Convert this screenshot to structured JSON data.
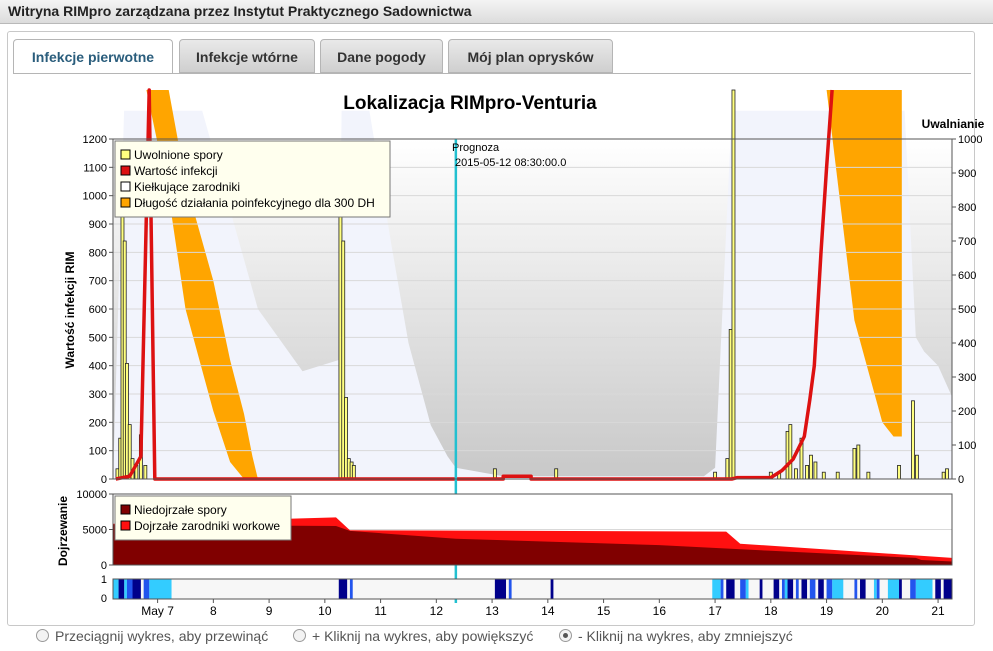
{
  "window": {
    "title": "Witryna RIMpro zarządzana przez Instytut Praktycznego Sadownictwa"
  },
  "tabs": [
    {
      "label": "Infekcje pierwotne",
      "active": true
    },
    {
      "label": "Infekcje wtórne",
      "active": false
    },
    {
      "label": "Dane pogody",
      "active": false
    },
    {
      "label": "Mój plan oprysków",
      "active": false
    }
  ],
  "colors": {
    "released_spores": "#ffff80",
    "infection_value": "#dd1111",
    "germinating": "#f2f4fc",
    "postinfection": "#ffa500",
    "immature": "#800000",
    "mature": "#ff1010",
    "forecast_line": "#22c0d0",
    "wet_dark": "#00008b",
    "wet_mid": "#2255ee",
    "wet_light": "#33ccff"
  },
  "chart_data": {
    "type": "bar",
    "title": "Lokalizacja RIMpro-Venturia",
    "ylabel": "Wartość infekcji RIM",
    "y2label": "Uwalnianie",
    "ylim": [
      0,
      1200
    ],
    "yticks": [
      0,
      100,
      200,
      300,
      400,
      500,
      600,
      700,
      800,
      900,
      1000,
      1100,
      1200
    ],
    "y2lim": [
      0,
      1000
    ],
    "y2ticks": [
      0,
      100,
      200,
      300,
      400,
      500,
      600,
      700,
      800,
      900,
      1000
    ],
    "xlim": [
      6.2,
      21.25
    ],
    "xticks": [
      {
        "v": 7,
        "label": "May 7"
      },
      {
        "v": 8,
        "label": "8"
      },
      {
        "v": 9,
        "label": "9"
      },
      {
        "v": 10,
        "label": "10"
      },
      {
        "v": 11,
        "label": "11"
      },
      {
        "v": 12,
        "label": "12"
      },
      {
        "v": 13,
        "label": "13"
      },
      {
        "v": 14,
        "label": "14"
      },
      {
        "v": 15,
        "label": "15"
      },
      {
        "v": 16,
        "label": "16"
      },
      {
        "v": 17,
        "label": "17"
      },
      {
        "v": 18,
        "label": "18"
      },
      {
        "v": 19,
        "label": "19"
      },
      {
        "v": 20,
        "label": "20"
      },
      {
        "v": 21,
        "label": "21"
      }
    ],
    "forecast": {
      "label": "Prognoza",
      "date": "2015-05-12 08:30:00.0",
      "x": 12.35
    },
    "legend": {
      "position": "top-left",
      "entries": [
        "Uwolnione spory",
        "Wartość infekcji",
        "Kiełkujące zarodniki",
        "Długość działania poinfekcyjnego dla 300 DH"
      ]
    },
    "released_spores": [
      [
        6.28,
        30
      ],
      [
        6.33,
        120
      ],
      [
        6.37,
        880
      ],
      [
        6.41,
        700
      ],
      [
        6.45,
        340
      ],
      [
        6.5,
        160
      ],
      [
        6.55,
        60
      ],
      [
        6.62,
        40
      ],
      [
        6.7,
        130
      ],
      [
        6.78,
        40
      ],
      [
        10.28,
        960
      ],
      [
        10.33,
        700
      ],
      [
        10.38,
        240
      ],
      [
        10.43,
        60
      ],
      [
        10.48,
        50
      ],
      [
        10.52,
        40
      ],
      [
        13.05,
        30
      ],
      [
        14.15,
        30
      ],
      [
        17.0,
        20
      ],
      [
        17.22,
        60
      ],
      [
        17.28,
        440
      ],
      [
        17.33,
        1200
      ],
      [
        18.0,
        20
      ],
      [
        18.15,
        20
      ],
      [
        18.3,
        140
      ],
      [
        18.35,
        160
      ],
      [
        18.45,
        30
      ],
      [
        18.55,
        120
      ],
      [
        18.65,
        40
      ],
      [
        18.72,
        70
      ],
      [
        18.8,
        50
      ],
      [
        18.95,
        20
      ],
      [
        19.2,
        20
      ],
      [
        19.5,
        90
      ],
      [
        19.57,
        100
      ],
      [
        19.75,
        20
      ],
      [
        20.3,
        40
      ],
      [
        20.55,
        230
      ],
      [
        20.62,
        70
      ],
      [
        21.1,
        20
      ],
      [
        21.16,
        30
      ]
    ],
    "infection_value": [
      [
        6.25,
        0
      ],
      [
        6.5,
        10
      ],
      [
        6.7,
        80
      ],
      [
        6.85,
        1400
      ],
      [
        6.95,
        0
      ],
      [
        13.2,
        0
      ],
      [
        13.2,
        10
      ],
      [
        13.7,
        10
      ],
      [
        13.7,
        0
      ],
      [
        17.3,
        0
      ],
      [
        17.4,
        5
      ],
      [
        18.0,
        5
      ],
      [
        18.2,
        30
      ],
      [
        18.4,
        70
      ],
      [
        18.6,
        150
      ],
      [
        18.7,
        280
      ],
      [
        18.78,
        400
      ],
      [
        18.9,
        800
      ],
      [
        19.0,
        1100
      ],
      [
        19.1,
        1400
      ]
    ],
    "germinating_area": [
      [
        6.2,
        0
      ],
      [
        6.4,
        1300
      ],
      [
        7.8,
        1300
      ],
      [
        8.8,
        600
      ],
      [
        9.6,
        380
      ],
      [
        10.25,
        420
      ],
      [
        10.3,
        1300
      ],
      [
        10.8,
        1300
      ],
      [
        11.2,
        820
      ],
      [
        11.5,
        480
      ],
      [
        11.9,
        190
      ],
      [
        12.2,
        80
      ],
      [
        12.35,
        40
      ],
      [
        13.2,
        10
      ],
      [
        16.8,
        10
      ],
      [
        17.0,
        40
      ],
      [
        17.3,
        1300
      ],
      [
        20.4,
        1300
      ],
      [
        20.6,
        500
      ],
      [
        20.75,
        450
      ],
      [
        21.0,
        400
      ],
      [
        21.25,
        290
      ],
      [
        21.25,
        0
      ]
    ],
    "postinfection_band": [
      {
        "x": [
          6.8,
          7.2,
          7.5,
          8.0,
          8.3,
          8.55,
          8.7,
          8.8
        ],
        "upper": [
          1400,
          1400,
          1050,
          700,
          420,
          230,
          80,
          0
        ],
        "lower": [
          1400,
          1000,
          600,
          240,
          60,
          0,
          0,
          0
        ]
      },
      {
        "x": [
          19.0,
          19.5,
          20.0,
          20.2,
          20.35
        ],
        "upper": [
          1400,
          1400,
          1400,
          1400,
          1400
        ],
        "lower": [
          1400,
          560,
          200,
          150,
          150
        ]
      }
    ],
    "maturation": {
      "ylabel": "Dojrzewanie",
      "ylim": [
        0,
        10000
      ],
      "yticks": [
        0,
        5000,
        10000
      ],
      "legend": [
        "Niedojrzałe spory",
        "Dojrzałe zarodniki workowe"
      ],
      "total": [
        [
          6.2,
          5800
        ],
        [
          10.2,
          6700
        ],
        [
          10.45,
          4900
        ],
        [
          17.2,
          4700
        ],
        [
          17.45,
          3000
        ],
        [
          21.25,
          1000
        ]
      ],
      "immature": [
        [
          6.2,
          5700
        ],
        [
          10.2,
          5500
        ],
        [
          10.45,
          4800
        ],
        [
          12.35,
          3700
        ],
        [
          16.0,
          2800
        ],
        [
          18.0,
          2000
        ],
        [
          20.6,
          1000
        ],
        [
          20.7,
          700
        ],
        [
          21.25,
          500
        ]
      ]
    },
    "wetness": {
      "yticks": [
        0,
        1
      ],
      "dark": [
        [
          6.3,
          6.4
        ],
        [
          6.55,
          6.7
        ],
        [
          10.25,
          10.4
        ],
        [
          13.05,
          13.25
        ],
        [
          14.05,
          14.1
        ],
        [
          17.2,
          17.35
        ],
        [
          17.8,
          17.85
        ],
        [
          18.05,
          18.15
        ],
        [
          18.3,
          18.4
        ],
        [
          18.55,
          18.65
        ],
        [
          18.85,
          18.95
        ],
        [
          19.6,
          19.7
        ],
        [
          20.3,
          20.35
        ],
        [
          20.95,
          21.05
        ],
        [
          21.1,
          21.25
        ]
      ],
      "mid": [
        [
          6.45,
          6.55
        ],
        [
          6.75,
          6.85
        ],
        [
          10.45,
          10.5
        ],
        [
          13.3,
          13.35
        ],
        [
          17.1,
          17.15
        ],
        [
          17.45,
          17.55
        ],
        [
          18.2,
          18.25
        ],
        [
          18.45,
          18.5
        ],
        [
          18.7,
          18.8
        ],
        [
          19.0,
          19.1
        ],
        [
          19.5,
          19.55
        ],
        [
          19.9,
          19.95
        ],
        [
          20.5,
          20.6
        ]
      ],
      "light": [
        [
          6.2,
          6.3
        ],
        [
          6.4,
          6.45
        ],
        [
          6.85,
          7.25
        ],
        [
          16.95,
          17.1
        ],
        [
          17.55,
          17.6
        ],
        [
          18.25,
          18.3
        ],
        [
          19.1,
          19.3
        ],
        [
          19.85,
          19.9
        ],
        [
          20.1,
          20.3
        ],
        [
          20.6,
          20.9
        ]
      ]
    }
  },
  "footer": {
    "opt1": "Przeciągnij wykres, aby przewinąć",
    "opt2": "+ Kliknij na wykres, aby powiększyć",
    "opt3": "- Kliknij na wykres, aby zmniejszyć",
    "selected": 3
  }
}
